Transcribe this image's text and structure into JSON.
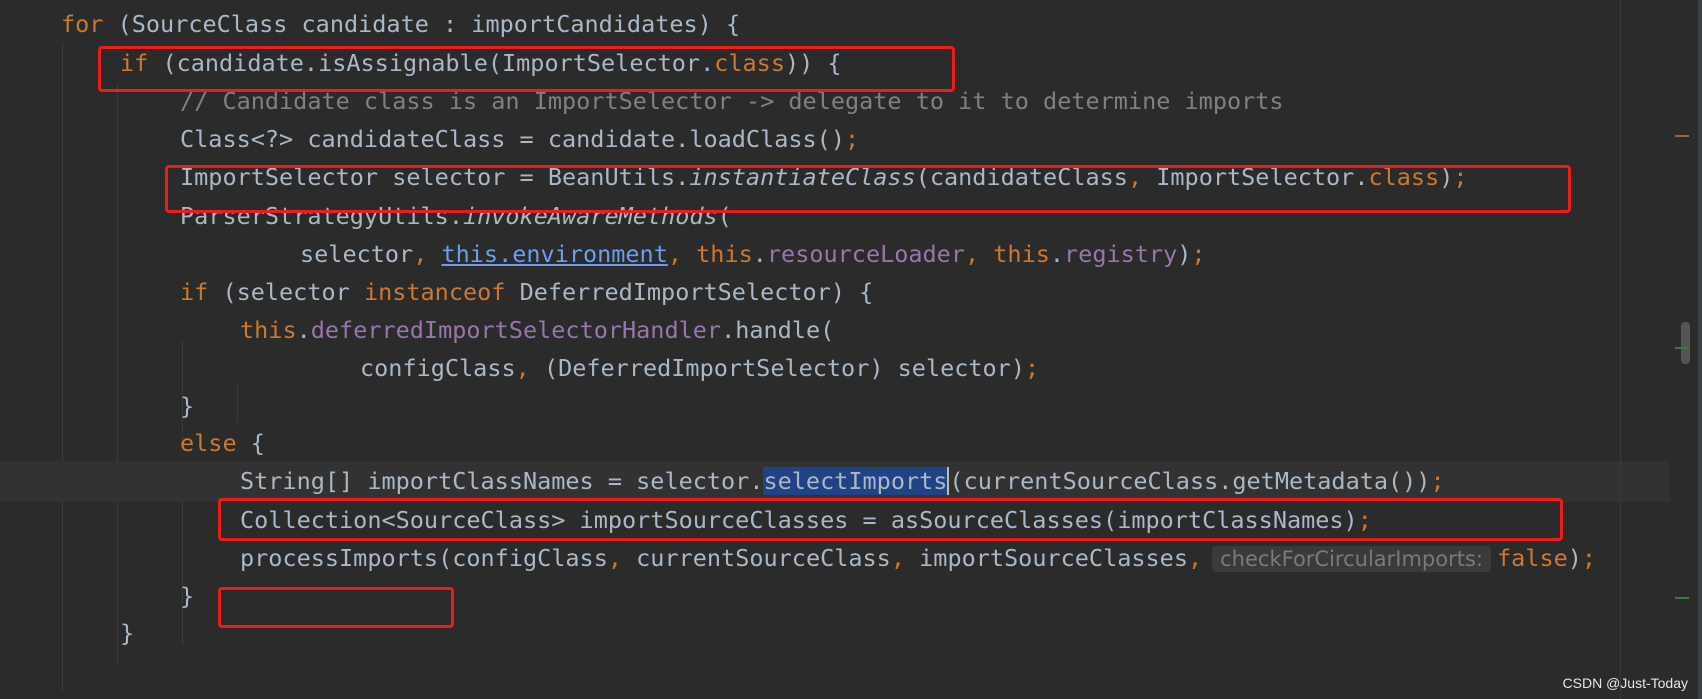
{
  "editor": {
    "lines": [
      [
        {
          "t": "kw",
          "v": "for"
        },
        {
          "t": "p",
          "v": " (SourceClass candidate : importCandidates) {"
        }
      ],
      [
        {
          "t": "kw",
          "v": "if"
        },
        {
          "t": "p",
          "v": " (candidate.isAssignable(ImportSelector."
        },
        {
          "t": "kw",
          "v": "class"
        },
        {
          "t": "p",
          "v": ")) {"
        }
      ],
      [
        {
          "t": "cm",
          "v": "// Candidate class is an ImportSelector -> delegate to it to determine imports"
        }
      ],
      [
        {
          "t": "p",
          "v": "Class<?> candidateClass = candidate.loadClass()"
        },
        {
          "t": "kw",
          "v": ";"
        }
      ],
      [
        {
          "t": "p",
          "v": "ImportSelector selector = BeanUtils."
        },
        {
          "t": "it",
          "v": "instantiateClass"
        },
        {
          "t": "p",
          "v": "(candidateClass"
        },
        {
          "t": "kw",
          "v": ","
        },
        {
          "t": "p",
          "v": " ImportSelector."
        },
        {
          "t": "kw",
          "v": "class"
        },
        {
          "t": "p",
          "v": ")"
        },
        {
          "t": "kw",
          "v": ";"
        }
      ],
      [
        {
          "t": "p",
          "v": "ParserStrategyUtils."
        },
        {
          "t": "it",
          "v": "invokeAwareMethods"
        },
        {
          "t": "p",
          "v": "("
        }
      ],
      [
        {
          "t": "p",
          "v": "selector"
        },
        {
          "t": "kw",
          "v": ", "
        },
        {
          "t": "link",
          "v": "this.environment"
        },
        {
          "t": "kw",
          "v": ", this"
        },
        {
          "t": "p",
          "v": "."
        },
        {
          "t": "fld",
          "v": "resourceLoader"
        },
        {
          "t": "kw",
          "v": ", this"
        },
        {
          "t": "p",
          "v": "."
        },
        {
          "t": "fld",
          "v": "registry"
        },
        {
          "t": "p",
          "v": ")"
        },
        {
          "t": "kw",
          "v": ";"
        }
      ],
      [
        {
          "t": "kw",
          "v": "if"
        },
        {
          "t": "p",
          "v": " (selector "
        },
        {
          "t": "kw",
          "v": "instanceof"
        },
        {
          "t": "p",
          "v": " DeferredImportSelector) {"
        }
      ],
      [
        {
          "t": "kw",
          "v": "this"
        },
        {
          "t": "p",
          "v": "."
        },
        {
          "t": "fld",
          "v": "deferredImportSelectorHandler"
        },
        {
          "t": "p",
          "v": ".handle("
        }
      ],
      [
        {
          "t": "p",
          "v": "configClass"
        },
        {
          "t": "kw",
          "v": ","
        },
        {
          "t": "p",
          "v": " (DeferredImportSelector) selector)"
        },
        {
          "t": "kw",
          "v": ";"
        }
      ],
      [
        {
          "t": "p",
          "v": "}"
        }
      ],
      [
        {
          "t": "kw",
          "v": "else"
        },
        {
          "t": "p",
          "v": " {"
        }
      ],
      [
        {
          "t": "p",
          "v": "String[] importClassNames = selector."
        },
        {
          "t": "sel",
          "v": "selectImports"
        },
        {
          "t": "caret",
          "v": ""
        },
        {
          "t": "p",
          "v": "(currentSourceClass.getMetadata())"
        },
        {
          "t": "kw",
          "v": ";"
        }
      ],
      [
        {
          "t": "p",
          "v": "Collection<SourceClass> importSourceClasses = asSourceClasses(importClassNames)"
        },
        {
          "t": "kw",
          "v": ";"
        }
      ],
      [
        {
          "t": "p",
          "v": "processImports(configClass"
        },
        {
          "t": "kw",
          "v": ","
        },
        {
          "t": "p",
          "v": " currentSourceClass"
        },
        {
          "t": "kw",
          "v": ","
        },
        {
          "t": "p",
          "v": " importSourceClasses"
        },
        {
          "t": "kw",
          "v": ","
        },
        {
          "t": "hint",
          "v": "checkForCircularImports:"
        },
        {
          "t": "kw",
          "v": "false"
        },
        {
          "t": "p",
          "v": ")"
        },
        {
          "t": "kw",
          "v": ";"
        }
      ],
      [
        {
          "t": "p",
          "v": "}"
        }
      ],
      [
        {
          "t": "p",
          "v": "}"
        }
      ]
    ]
  },
  "colors": {
    "background": "#2b2b2b",
    "text": "#a9b7c6",
    "keyword": "#cc7832",
    "comment": "#808080",
    "field": "#9876aa",
    "link": "#6d9ded",
    "selection": "#214283",
    "highlight_box": "#ee1c1c"
  },
  "watermark": "CSDN @Just-Today"
}
